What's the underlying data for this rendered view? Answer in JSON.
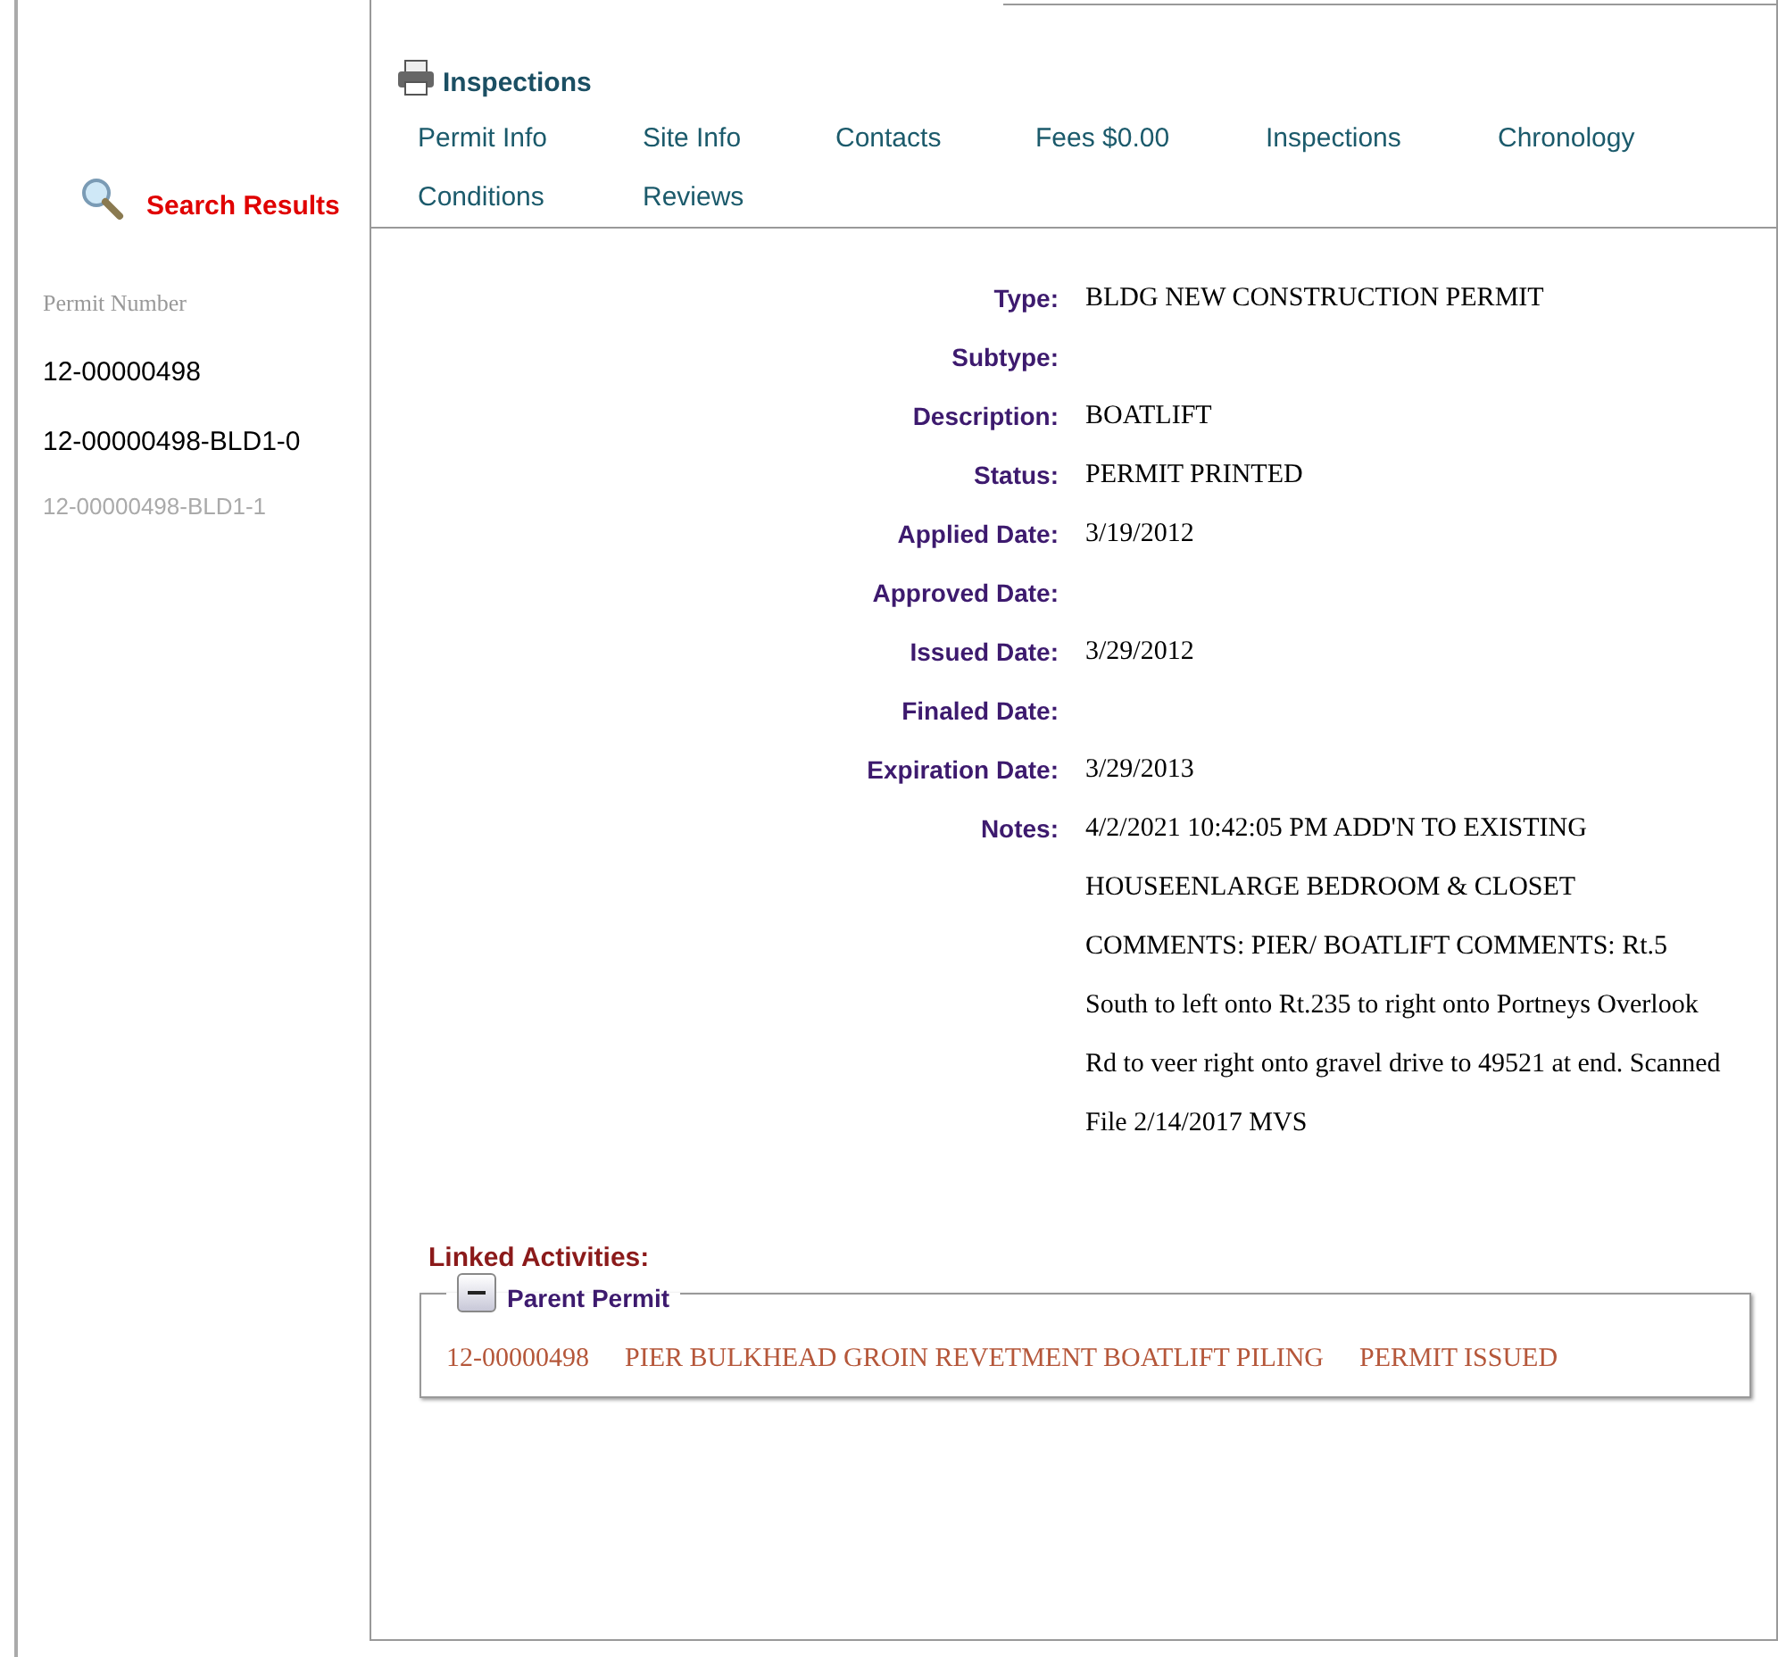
{
  "sidebar": {
    "heading": "Search Results",
    "column_label": "Permit Number",
    "items": [
      {
        "label": "12-00000498",
        "selected": false
      },
      {
        "label": "12-00000498-BLD1-0",
        "selected": false
      },
      {
        "label": "12-00000498-BLD1-1",
        "selected": true
      }
    ]
  },
  "toolbar": {
    "print_label": "Inspections"
  },
  "tabs": [
    {
      "label": "Permit Info"
    },
    {
      "label": "Site Info"
    },
    {
      "label": "Contacts"
    },
    {
      "label": "Fees $0.00"
    },
    {
      "label": "Inspections"
    },
    {
      "label": "Chronology"
    },
    {
      "label": "Conditions"
    },
    {
      "label": "Reviews"
    }
  ],
  "details": [
    {
      "label": "Type:",
      "value": "BLDG NEW CONSTRUCTION PERMIT"
    },
    {
      "label": "Subtype:"
    },
    {
      "label": "Description:",
      "value": "BOATLIFT"
    },
    {
      "label": "Status:",
      "value": "PERMIT PRINTED"
    },
    {
      "label": "Applied Date:",
      "value": "3/19/2012"
    },
    {
      "label": "Approved Date:"
    },
    {
      "label": "Issued Date:",
      "value": "3/29/2012"
    },
    {
      "label": "Finaled Date:"
    },
    {
      "label": "Expiration Date:",
      "value": "3/29/2013"
    },
    {
      "label": "Notes:",
      "value": "4/2/2021 10:42:05 PM ADD'N TO EXISTING HOUSEENLARGE BEDROOM & CLOSET COMMENTS: PIER/ BOATLIFT COMMENTS: Rt.5 South to left onto Rt.235 to right onto Portneys Overlook Rd to veer right onto gravel drive to 49521 at end. Scanned File 2/14/2017 MVS"
    }
  ],
  "linked_activities": {
    "heading": "Linked Activities:",
    "group": {
      "title": "Parent Permit",
      "expanded": true,
      "rows": [
        {
          "number": "12-00000498",
          "description": "PIER BULKHEAD GROIN REVETMENT BOATLIFT PILING",
          "status": "PERMIT ISSUED"
        }
      ]
    }
  }
}
